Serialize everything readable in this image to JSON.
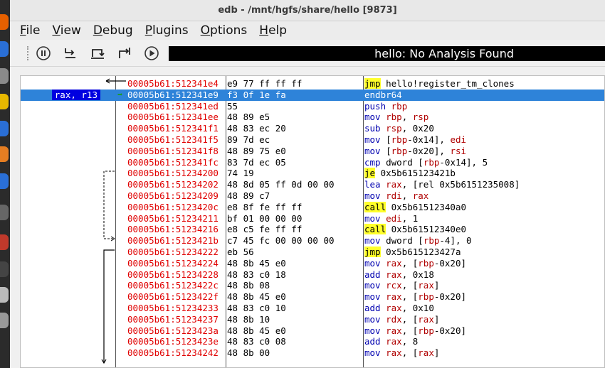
{
  "window_title": "edb - /mnt/hgfs/share/hello [9873]",
  "menu": [
    {
      "underline": "F",
      "rest": "ile"
    },
    {
      "underline": "V",
      "rest": "iew"
    },
    {
      "underline": "D",
      "rest": "ebug"
    },
    {
      "underline": "P",
      "rest": "lugins"
    },
    {
      "underline": "O",
      "rest": "ptions"
    },
    {
      "underline": "H",
      "rest": "elp"
    }
  ],
  "toolbar": {
    "buttons": [
      "pause-icon",
      "step-into-icon",
      "step-over-icon",
      "step-out-icon",
      "run-icon"
    ],
    "status": "hello: No Analysis Found"
  },
  "colors": {
    "address": "#e00000",
    "mnemonic": "#0000b0",
    "branch_highlight": "#ffff2a",
    "selection": "#2e83d9",
    "register_tag": "#0000e0"
  },
  "disassembly": [
    {
      "reg": "",
      "addr": "00005b61:512341e4",
      "bytes": "e9 77 ff ff ff",
      "mn": "jmp",
      "hl": true,
      "ops": "hello!register_tm_clones"
    },
    {
      "reg": "rax, r13",
      "addr": "00005b61:512341e9",
      "bytes": "f3 0f 1e fa",
      "mn": "endbr64",
      "hl": false,
      "ops": "",
      "selected": true
    },
    {
      "reg": "",
      "addr": "00005b61:512341ed",
      "bytes": "55",
      "mn": "push",
      "hl": false,
      "ops": "rbp"
    },
    {
      "reg": "",
      "addr": "00005b61:512341ee",
      "bytes": "48 89 e5",
      "mn": "mov",
      "hl": false,
      "ops": "rbp, rsp"
    },
    {
      "reg": "",
      "addr": "00005b61:512341f1",
      "bytes": "48 83 ec 20",
      "mn": "sub",
      "hl": false,
      "ops": "rsp, 0x20"
    },
    {
      "reg": "",
      "addr": "00005b61:512341f5",
      "bytes": "89 7d ec",
      "mn": "mov",
      "hl": false,
      "ops": "[rbp-0x14], edi"
    },
    {
      "reg": "",
      "addr": "00005b61:512341f8",
      "bytes": "48 89 75 e0",
      "mn": "mov",
      "hl": false,
      "ops": "[rbp-0x20], rsi"
    },
    {
      "reg": "",
      "addr": "00005b61:512341fc",
      "bytes": "83 7d ec 05",
      "mn": "cmp",
      "hl": false,
      "ops": "dword [rbp-0x14], 5"
    },
    {
      "reg": "",
      "addr": "00005b61:51234200",
      "bytes": "74 19",
      "mn": "je",
      "hl": true,
      "ops": "0x5b615123421b"
    },
    {
      "reg": "",
      "addr": "00005b61:51234202",
      "bytes": "48 8d 05 ff 0d 00 00",
      "mn": "lea",
      "hl": false,
      "ops": "rax, [rel 0x5b6151235008]"
    },
    {
      "reg": "",
      "addr": "00005b61:51234209",
      "bytes": "48 89 c7",
      "mn": "mov",
      "hl": false,
      "ops": "rdi, rax"
    },
    {
      "reg": "",
      "addr": "00005b61:5123420c",
      "bytes": "e8 8f fe ff ff",
      "mn": "call",
      "hl": true,
      "ops": "0x5b61512340a0"
    },
    {
      "reg": "",
      "addr": "00005b61:51234211",
      "bytes": "bf 01 00 00 00",
      "mn": "mov",
      "hl": false,
      "ops": "edi, 1"
    },
    {
      "reg": "",
      "addr": "00005b61:51234216",
      "bytes": "e8 c5 fe ff ff",
      "mn": "call",
      "hl": true,
      "ops": "0x5b61512340e0"
    },
    {
      "reg": "",
      "addr": "00005b61:5123421b",
      "bytes": "c7 45 fc 00 00 00 00",
      "mn": "mov",
      "hl": false,
      "ops": "dword [rbp-4], 0"
    },
    {
      "reg": "",
      "addr": "00005b61:51234222",
      "bytes": "eb 56",
      "mn": "jmp",
      "hl": true,
      "ops": "0x5b615123427a"
    },
    {
      "reg": "",
      "addr": "00005b61:51234224",
      "bytes": "48 8b 45 e0",
      "mn": "mov",
      "hl": false,
      "ops": "rax, [rbp-0x20]"
    },
    {
      "reg": "",
      "addr": "00005b61:51234228",
      "bytes": "48 83 c0 18",
      "mn": "add",
      "hl": false,
      "ops": "rax, 0x18"
    },
    {
      "reg": "",
      "addr": "00005b61:5123422c",
      "bytes": "48 8b 08",
      "mn": "mov",
      "hl": false,
      "ops": "rcx, [rax]"
    },
    {
      "reg": "",
      "addr": "00005b61:5123422f",
      "bytes": "48 8b 45 e0",
      "mn": "mov",
      "hl": false,
      "ops": "rax, [rbp-0x20]"
    },
    {
      "reg": "",
      "addr": "00005b61:51234233",
      "bytes": "48 83 c0 10",
      "mn": "add",
      "hl": false,
      "ops": "rax, 0x10"
    },
    {
      "reg": "",
      "addr": "00005b61:51234237",
      "bytes": "48 8b 10",
      "mn": "mov",
      "hl": false,
      "ops": "rdx, [rax]"
    },
    {
      "reg": "",
      "addr": "00005b61:5123423a",
      "bytes": "48 8b 45 e0",
      "mn": "mov",
      "hl": false,
      "ops": "rax, [rbp-0x20]"
    },
    {
      "reg": "",
      "addr": "00005b61:5123423e",
      "bytes": "48 83 c0 08",
      "mn": "add",
      "hl": false,
      "ops": "rax, 8"
    },
    {
      "reg": "",
      "addr": "00005b61:51234242",
      "bytes": "48 8b 00",
      "mn": "mov",
      "hl": false,
      "ops": "rax, [rax]"
    }
  ]
}
